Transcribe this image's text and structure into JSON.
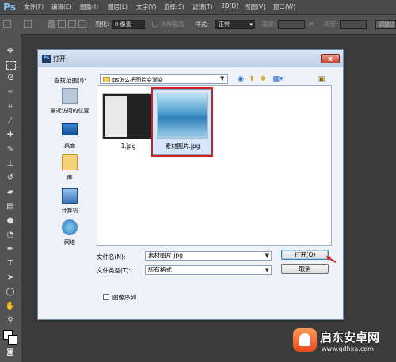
{
  "app": {
    "logo": "Ps"
  },
  "menubar": {
    "items": [
      "文件(F)",
      "编辑(E)",
      "图像(I)",
      "图层(L)",
      "文字(Y)",
      "选择(S)",
      "滤镜(T)",
      "3D(D)",
      "视图(V)",
      "窗口(W)"
    ]
  },
  "optionsbar": {
    "feather_label": "羽化:",
    "feather_value": "0 像素",
    "antialias_label": "消除锯齿",
    "style_label": "样式:",
    "style_value": "正常",
    "width_label": "宽度:",
    "height_label": "高度:",
    "refine_edge": "调整边"
  },
  "dialog": {
    "title": "打开",
    "close": "x",
    "look_in_label": "查找范围(I):",
    "look_in_value": "ps怎么把图片变渐变",
    "places": [
      {
        "label": "最近访问的位置",
        "icon": "recent-places-icon"
      },
      {
        "label": "桌面",
        "icon": "desktop-icon"
      },
      {
        "label": "库",
        "icon": "libraries-icon"
      },
      {
        "label": "计算机",
        "icon": "computer-icon"
      },
      {
        "label": "网络",
        "icon": "network-icon"
      }
    ],
    "files": [
      {
        "name": "1.jpg",
        "selected": false
      },
      {
        "name": "素材图片.jpg",
        "selected": true
      }
    ],
    "filename_label": "文件名(N):",
    "filename_value": "素材图片.jpg",
    "filetype_label": "文件类型(T):",
    "filetype_value": "所有格式",
    "open_button": "打开(O)",
    "cancel_button": "取消",
    "image_sequence_label": "图像序列"
  },
  "watermark": {
    "text": "启东安卓网",
    "url": "www.qdhxa.com"
  },
  "colors": {
    "highlight": "#cc2222",
    "ps_blue": "#7ec8f2"
  }
}
